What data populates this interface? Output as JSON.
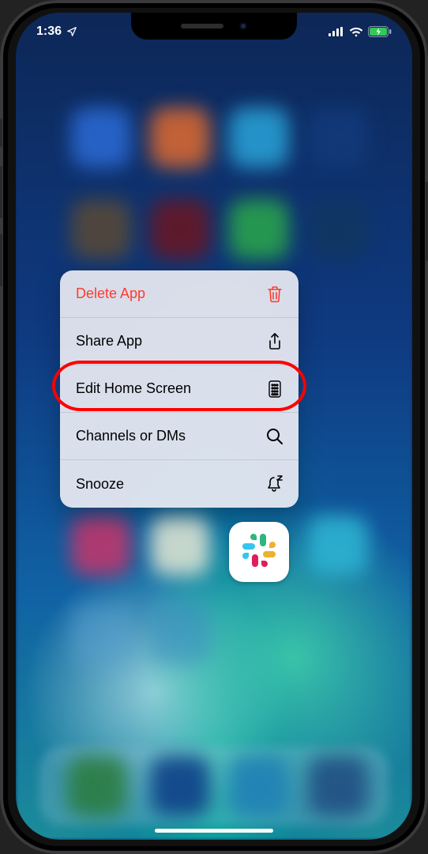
{
  "statusbar": {
    "time": "1:36"
  },
  "context_menu": {
    "items": [
      {
        "label": "Delete App",
        "icon": "trash-icon",
        "destructive": true
      },
      {
        "label": "Share App",
        "icon": "share-icon",
        "destructive": false
      },
      {
        "label": "Edit Home Screen",
        "icon": "apps-grid-icon",
        "destructive": false
      },
      {
        "label": "Channels or DMs",
        "icon": "search-icon",
        "destructive": false
      },
      {
        "label": "Snooze",
        "icon": "bell-snooze-icon",
        "destructive": false
      }
    ]
  },
  "highlighted_item_index": 2,
  "app": {
    "name": "Slack"
  },
  "colors": {
    "destructive": "#ff3b30",
    "highlight": "#ff0000"
  }
}
